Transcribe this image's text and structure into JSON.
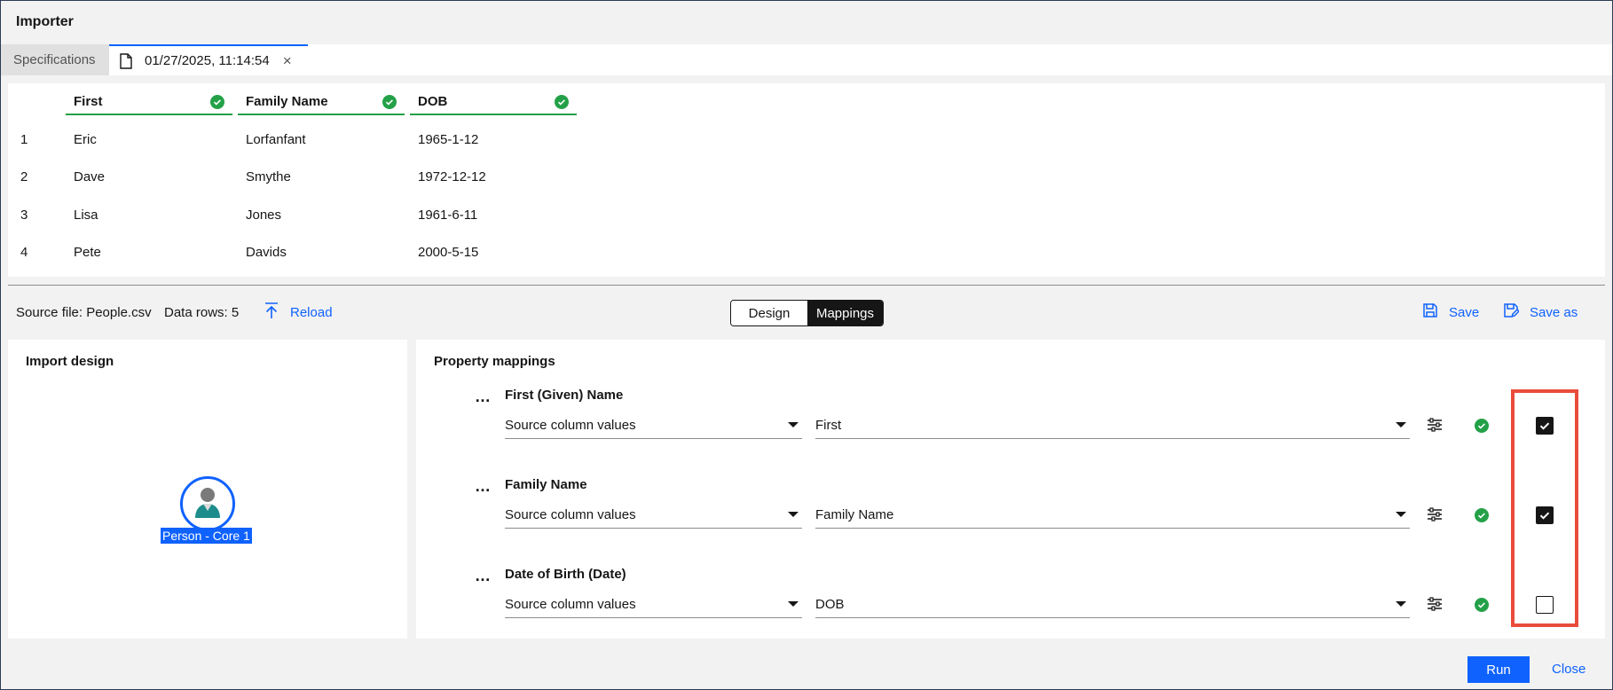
{
  "window": {
    "title": "Importer"
  },
  "tabs": [
    {
      "label": "Specifications",
      "active": false
    },
    {
      "label": "01/27/2025, 11:14:54",
      "active": true,
      "icon": "document-icon",
      "close": "×"
    }
  ],
  "preview": {
    "columns": [
      "First",
      "Family Name",
      "DOB"
    ],
    "rows": [
      {
        "index": "1",
        "cells": [
          "Eric",
          "Lorfanfant",
          "1965-1-12"
        ]
      },
      {
        "index": "2",
        "cells": [
          "Dave",
          "Smythe",
          "1972-12-12"
        ]
      },
      {
        "index": "3",
        "cells": [
          "Lisa",
          "Jones",
          "1961-6-11"
        ]
      },
      {
        "index": "4",
        "cells": [
          "Pete",
          "Davids",
          "2000-5-15"
        ]
      }
    ]
  },
  "toolbar": {
    "source_file": "Source file: People.csv",
    "data_rows": "Data rows: 5",
    "reload": "Reload",
    "view_toggle": {
      "design": "Design",
      "mappings": "Mappings",
      "selected": "Mappings"
    },
    "save": "Save",
    "save_as": "Save as"
  },
  "import_design": {
    "title": "Import design",
    "node_label": "Person - Core 1",
    "node_icon": "person-icon"
  },
  "property_mappings": {
    "title": "Property mappings",
    "rows": [
      {
        "name": "First (Given) Name",
        "source_type": "Source column values",
        "source_column": "First",
        "checked": true
      },
      {
        "name": "Family Name",
        "source_type": "Source column values",
        "source_column": "Family Name",
        "checked": true
      },
      {
        "name": "Date of Birth (Date)",
        "source_type": "Source column values",
        "source_column": "DOB",
        "checked": false
      }
    ],
    "more_icon": "…"
  },
  "footer": {
    "run": "Run",
    "close": "Close"
  },
  "colors": {
    "accent": "#0f62fe",
    "success": "#24a148",
    "highlight": "#ea4c3c"
  }
}
